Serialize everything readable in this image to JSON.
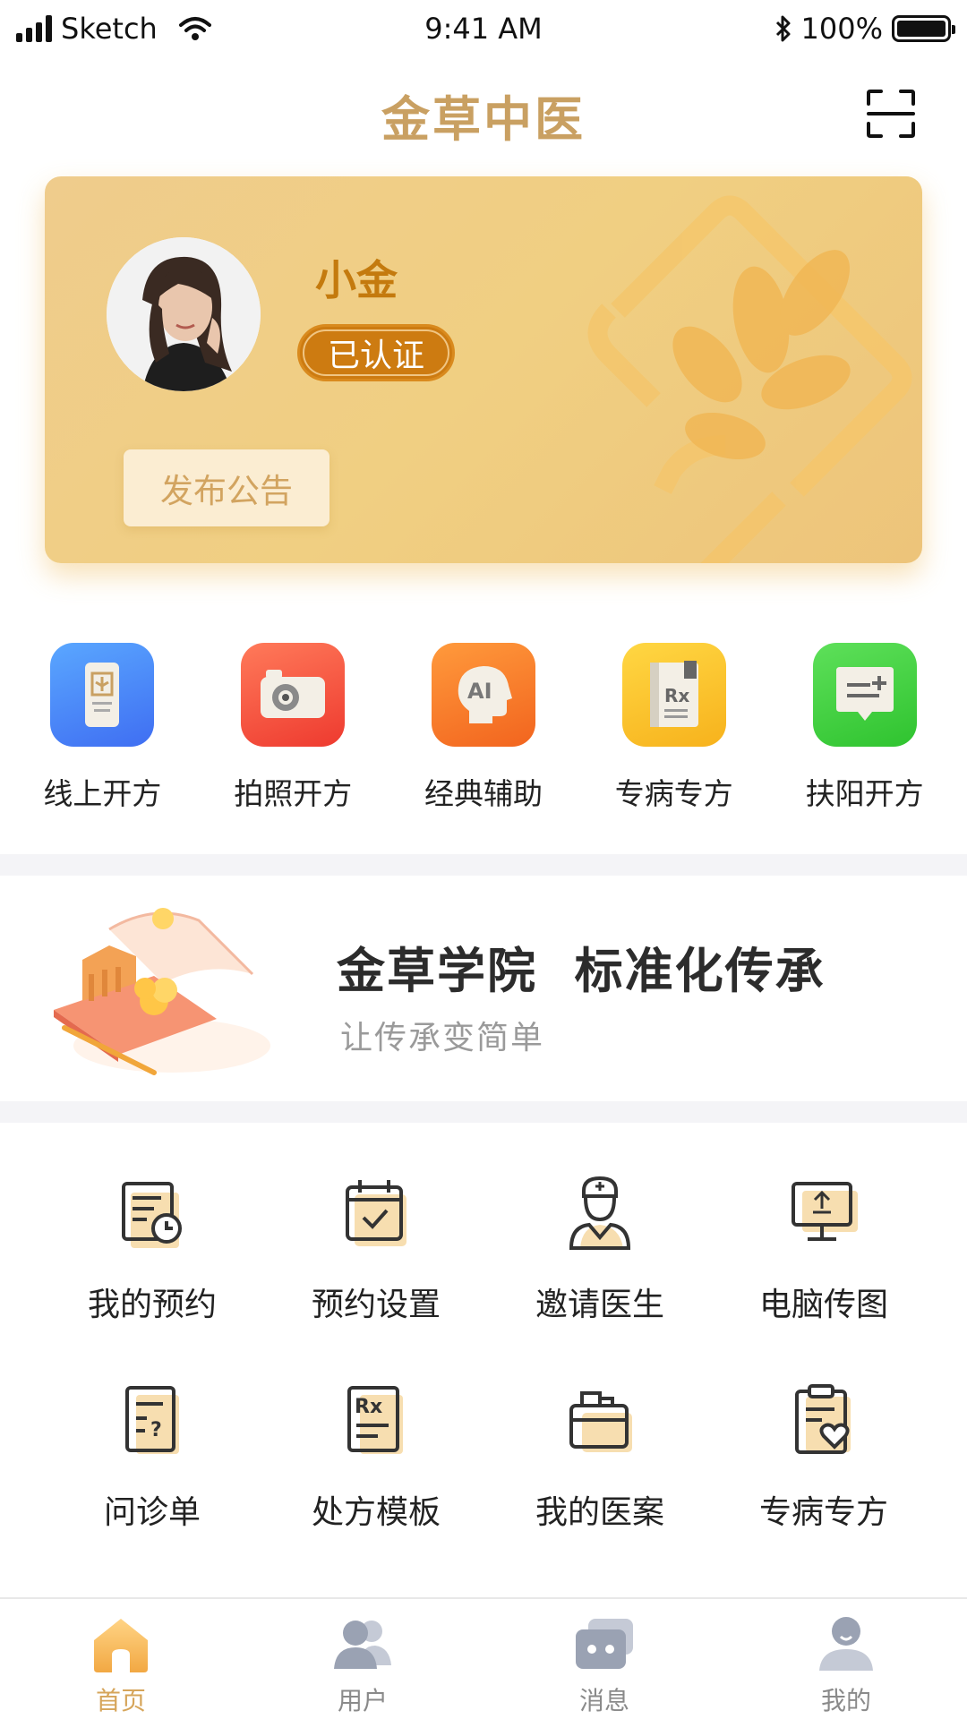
{
  "status_bar": {
    "carrier": "Sketch",
    "time": "9:41 AM",
    "battery": "100%"
  },
  "header": {
    "title": "金草中医"
  },
  "profile": {
    "name": "小金",
    "badge": "已认证",
    "publish_button": "发布公告"
  },
  "quick_actions": [
    {
      "label": "线上开方",
      "icon": "phone-card-icon"
    },
    {
      "label": "拍照开方",
      "icon": "camera-icon"
    },
    {
      "label": "经典辅助",
      "icon": "ai-head-icon"
    },
    {
      "label": "专病专方",
      "icon": "rx-book-icon"
    },
    {
      "label": "扶阳开方",
      "icon": "message-add-icon"
    }
  ],
  "banner": {
    "title": "金草学院  标准化传承",
    "subtitle": "让传承变简单"
  },
  "tools": [
    {
      "label": "我的预约",
      "icon": "appointment-icon"
    },
    {
      "label": "预约设置",
      "icon": "calendar-check-icon"
    },
    {
      "label": "邀请医生",
      "icon": "doctor-icon"
    },
    {
      "label": "电脑传图",
      "icon": "computer-upload-icon"
    },
    {
      "label": "问诊单",
      "icon": "questionnaire-icon"
    },
    {
      "label": "处方模板",
      "icon": "rx-template-icon"
    },
    {
      "label": "我的医案",
      "icon": "folder-icon"
    },
    {
      "label": "专病专方",
      "icon": "clipboard-heart-icon"
    }
  ],
  "tabbar": [
    {
      "label": "首页",
      "icon": "home-icon",
      "active": true
    },
    {
      "label": "用户",
      "icon": "users-icon",
      "active": false
    },
    {
      "label": "消息",
      "icon": "message-icon",
      "active": false
    },
    {
      "label": "我的",
      "icon": "profile-icon",
      "active": false
    }
  ],
  "colors": {
    "accent": "#c9a062",
    "card": "#efcc8c",
    "badge": "#cd7b11"
  }
}
